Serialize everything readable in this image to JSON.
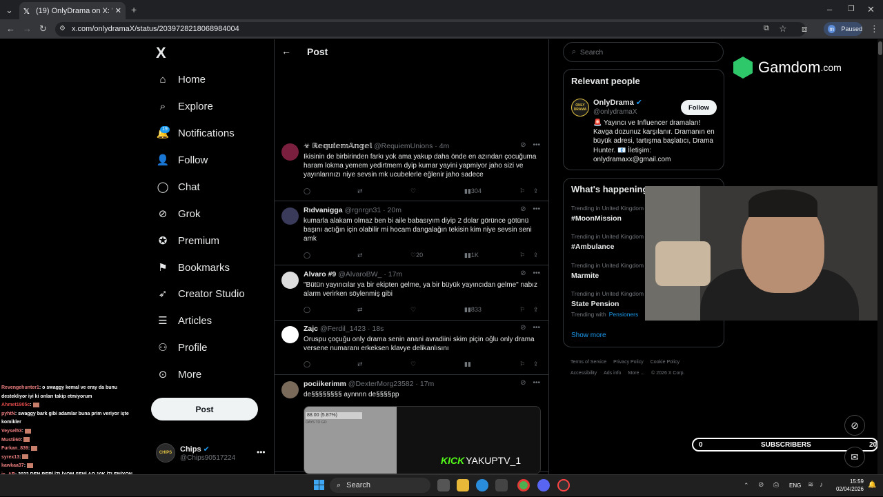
{
  "browser": {
    "tab_title": "(19) OnlyDrama on X: \"Chips (l...",
    "url": "x.com/onlydramaX/status/2039728218068984004",
    "profile_status": "Paused",
    "profile_initial": "m"
  },
  "nav": {
    "logo": "X",
    "items": [
      {
        "label": "Home",
        "icon": "home-icon"
      },
      {
        "label": "Explore",
        "icon": "search-icon"
      },
      {
        "label": "Notifications",
        "icon": "bell-icon"
      },
      {
        "label": "Follow",
        "icon": "person-plus-icon"
      },
      {
        "label": "Chat",
        "icon": "chat-icon"
      },
      {
        "label": "Grok",
        "icon": "grok-icon"
      },
      {
        "label": "Premium",
        "icon": "verified-icon"
      },
      {
        "label": "Bookmarks",
        "icon": "bookmark-icon"
      },
      {
        "label": "Creator Studio",
        "icon": "rocket-icon"
      },
      {
        "label": "Articles",
        "icon": "article-icon"
      },
      {
        "label": "Profile",
        "icon": "person-icon"
      },
      {
        "label": "More",
        "icon": "more-circle-icon"
      }
    ],
    "notifications_badge": "19",
    "post_button": "Post",
    "account": {
      "name": "Chips",
      "handle": "@Chips90517224",
      "avatar_text": "CHIPS"
    }
  },
  "main": {
    "header": "Post",
    "tweets": [
      {
        "name": "☣ ℝ𝕖𝕢𝕦𝕚𝕖𝕞𝔸𝕟𝕘𝕖𝕝",
        "handle": "@RequiemUnions",
        "time": "· 4m",
        "text": "Ikisinin de birbirinden farkı yok ama yakup daha önde en azından çocuğuma haram lokma yemem yedirtmem dyip kumar yayini yapmiyor jaho sizi ve yayınlarınızı niye sevsin mk ucubelerle eğlenir jaho sadece",
        "likes": "",
        "views": "304"
      },
      {
        "name": "Rıdvanigga",
        "handle": "@rgnrgn31",
        "time": "· 20m",
        "text": "kumarla alakam olmaz ben bi aile babasıyım diyip 2 dolar görünce götünü başını actığın için olabilir mi hocam dangalağın tekisin kim niye sevsin seni amk",
        "likes": "20",
        "views": "1K"
      },
      {
        "name": "Alvaro #9",
        "handle": "@AlvaroBW_",
        "time": "· 17m",
        "text": "\"Bütün yayıncılar ya bir ekipten gelme, ya bir büyük yayıncıdan gelme\" nabız alarm verirken söylenmiş gibi",
        "likes": "",
        "views": "833"
      },
      {
        "name": "Zajc",
        "handle": "@Ferdil_1423",
        "time": "· 18s",
        "text": "Oruspu çoçuğu only drama senin anani avradiini skim piçin oğlu only drama versene numaranı erkeksen klavye delikanlısını",
        "likes": "",
        "views": ""
      },
      {
        "name": "pociikerimm",
        "handle": "@DexterMorg23582",
        "time": "· 17m",
        "text": "de§§§§§§§§ aynnnn de§§§§pp",
        "likes": "",
        "views": ""
      }
    ],
    "media": {
      "percent": "88.00 (5.87%)",
      "sub": "DAYS TO GO",
      "kick": "KICK",
      "tag": "YAKUPTV_1"
    }
  },
  "sidebar": {
    "search_placeholder": "Search",
    "relevant_title": "Relevant people",
    "person": {
      "name": "OnlyDrama",
      "handle": "@onlydramaX",
      "follow": "Follow",
      "avatar_text": "ONLY DRAMA",
      "bio": "🚨 Yayıncı ve Influencer dramaları! Kavga dozunuz karşılanır. Dramanın en büyük adresi, tartışma başlatıcı, Drama Hunter. 📧 İletişim: onlydramaxx@gmail.com"
    },
    "whats_title": "What's happening",
    "trends": [
      {
        "meta": "Trending in United Kingdom",
        "name": "#MoonMission"
      },
      {
        "meta": "Trending in United Kingdom",
        "name": "#Ambulance"
      },
      {
        "meta": "Trending in United Kingdom",
        "name": "Marmite"
      },
      {
        "meta": "Trending in United Kingdom",
        "name": "State Pension"
      }
    ],
    "trending_with": "Trending with",
    "trending_with_link": "Pensioners",
    "show_more": "Show more",
    "footer": [
      "Terms of Service",
      "Privacy Policy",
      "Cookie Policy",
      "Accessibility",
      "Ads info",
      "More ...",
      "© 2026 X Corp."
    ]
  },
  "overlay": {
    "sponsor": "Gamdom",
    "sponsor_suffix": ".com",
    "subs_left": "0",
    "subs_label": "SUBSCRIBERS",
    "subs_right": "20",
    "chat": [
      {
        "user": "Revengehunter1",
        "msg": ": o swaggy kemal ve eray da bunu destekliyor iyi ki onları takip etmiyorum"
      },
      {
        "user": "Ahmet1905c",
        "msg": ":"
      },
      {
        "user": "pyhtN",
        "msg": ": swaggy bark gibi adamlar buna prim veriyor işte komikler"
      },
      {
        "user": "Veysel53",
        "msg": ":"
      },
      {
        "user": "Mustii60",
        "msg": ":"
      },
      {
        "user": "Furkan_839",
        "msg": ":"
      },
      {
        "user": "syrex13",
        "msg": ":"
      },
      {
        "user": "kawkaa37",
        "msg": ":"
      },
      {
        "user": "is_AR",
        "msg": ": 2022 DEN BERİ İZLİYOM SENİ AQ 10K İZLENİYON 300 İZLENEN PRİM ARAYAN ADAMA SÖVÜYON PRİM VERİP DEĞİL"
      }
    ]
  },
  "taskbar": {
    "search": "Search",
    "lang": "ENG",
    "time": "15:59",
    "date": "02/04/2026"
  }
}
